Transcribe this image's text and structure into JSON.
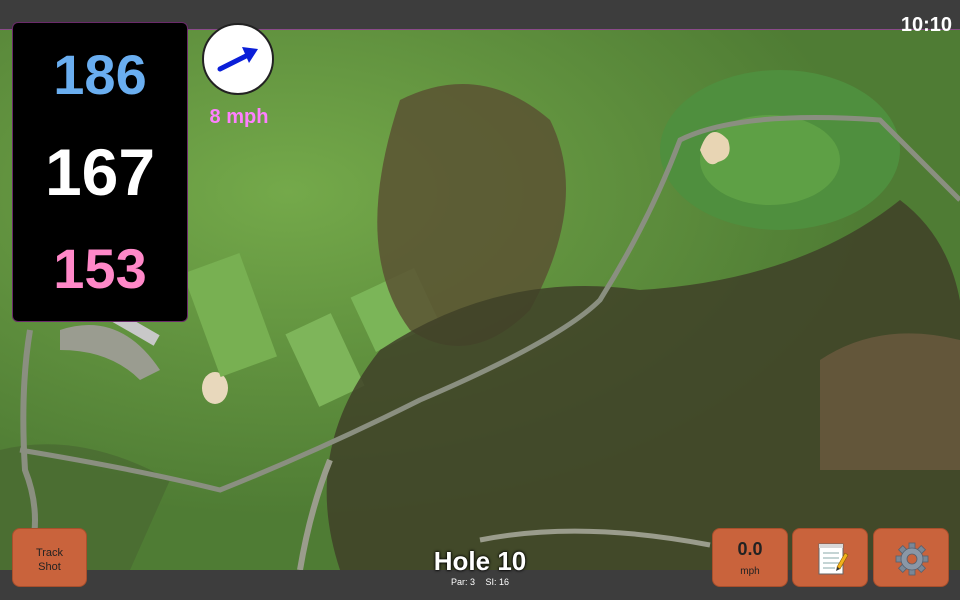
{
  "status": {
    "time": "10:10"
  },
  "distances": {
    "back": "186",
    "center": "167",
    "front": "153",
    "colors": {
      "back": "#6aaef0",
      "center": "#ffffff",
      "front": "#ff88c8"
    }
  },
  "wind": {
    "speed": "8 mph",
    "icon": "arrow-icon",
    "arrow_color": "#0a1ed8"
  },
  "buttons": {
    "track_shot": "Track\nShot",
    "speed_value": "0.0",
    "speed_unit": "mph",
    "notes_icon": "notepad-icon",
    "settings_icon": "gear-icon"
  },
  "hole": {
    "title": "Hole 10",
    "par": "Par: 3",
    "si": "SI: 16"
  },
  "colors": {
    "button": "#c9633c",
    "bar": "#3d3d3d"
  }
}
